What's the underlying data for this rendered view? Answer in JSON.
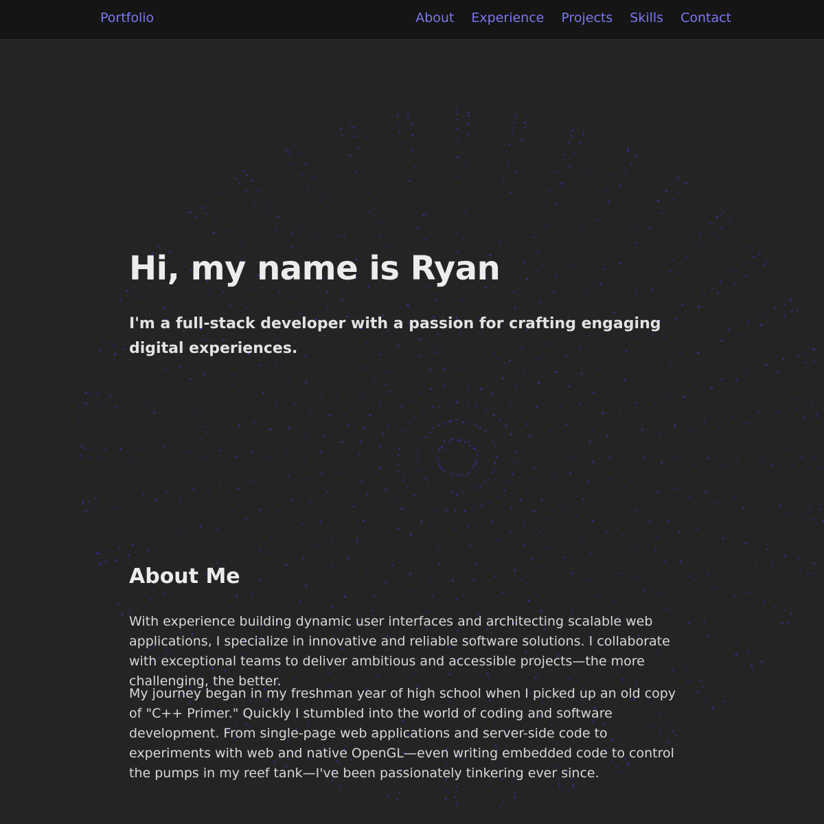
{
  "nav": {
    "brand": "Portfolio",
    "links": [
      "About",
      "Experience",
      "Projects",
      "Skills",
      "Contact"
    ]
  },
  "hero": {
    "title": "Hi, my name is Ryan",
    "subtitle": "I'm a full-stack developer with a passion for crafting engaging digital experiences."
  },
  "about": {
    "title": "About Me",
    "paragraphs": [
      "With experience building dynamic user interfaces and architecting scalable web applications, I specialize in innovative and reliable software solutions. I collaborate with exceptional teams to deliver ambitious and accessible projects—the more challenging, the better.",
      "My journey began in my freshman year of high school when I picked up an old copy of \"C++ Primer.\" Quickly I stumbled into the world of coding and software development. From single-page web applications and server-side code to experiments with web and native OpenGL—even writing embedded code to control the pumps in my reef tank—I've been passionately tinkering ever since."
    ]
  },
  "colors": {
    "background": "#242424",
    "navbar": "#151515",
    "accent": "#7b78f2",
    "particles": "#3a36d8"
  }
}
